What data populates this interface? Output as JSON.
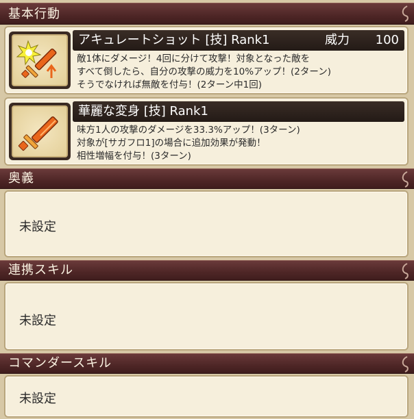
{
  "sections": {
    "basic": {
      "title": "基本行動"
    },
    "ougi": {
      "title": "奥義",
      "empty_text": "未設定"
    },
    "renkei": {
      "title": "連携スキル",
      "empty_text": "未設定"
    },
    "commander": {
      "title": "コマンダースキル",
      "empty_text": "未設定"
    }
  },
  "skills": [
    {
      "name": "アキュレートショット [技]  Rank1",
      "power_label": "威力",
      "power_value": "100",
      "description": [
        "敵1体にダメージ！4回に分けて攻撃！対象となった敵を",
        "すべて倒したら、自分の攻撃の威力を10%アップ！(2ターン)",
        "そうでなければ無敵を付与！(2ターン中1回)"
      ],
      "icon": "sword-burst-icon"
    },
    {
      "name": "華麗な変身 [技]  Rank1",
      "description": [
        "味方1人の攻撃のダメージを33.3%アップ！(3ターン)",
        "対象が[サガフロ1]の場合に追加効果が発動！",
        "相性増幅を付与！(3ターン)"
      ],
      "icon": "sword-icon"
    }
  ]
}
